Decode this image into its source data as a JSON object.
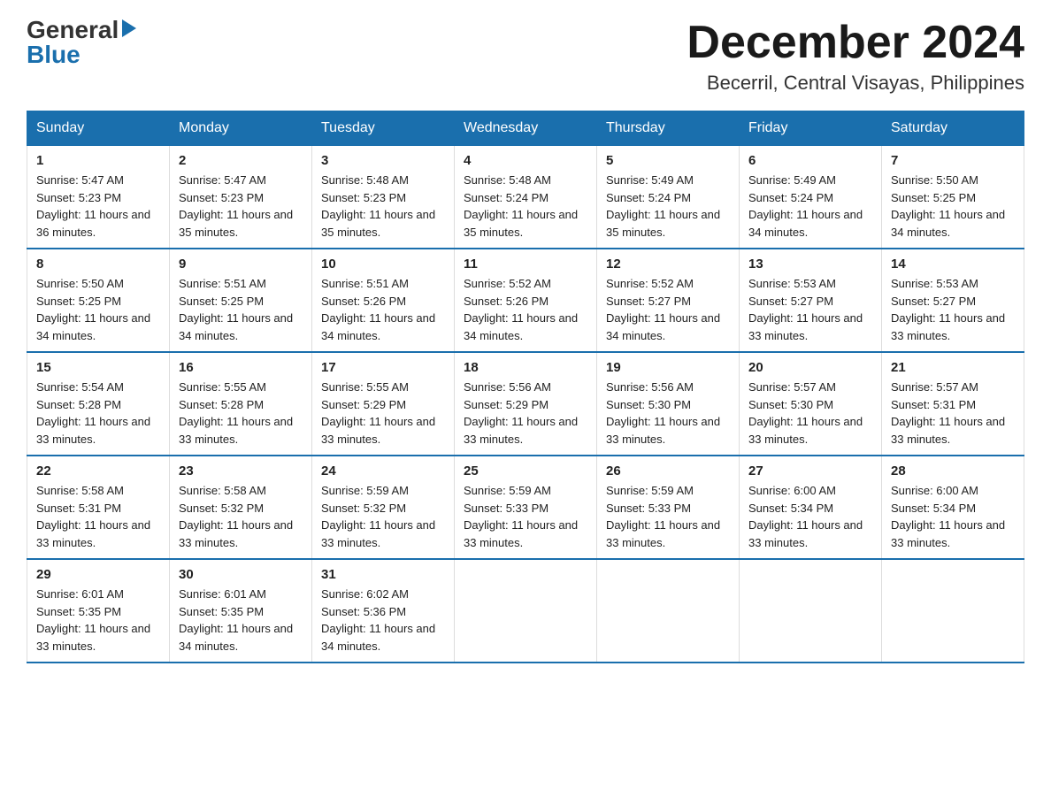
{
  "header": {
    "logo_general": "General",
    "logo_blue": "Blue",
    "month_title": "December 2024",
    "location": "Becerril, Central Visayas, Philippines"
  },
  "weekdays": [
    "Sunday",
    "Monday",
    "Tuesday",
    "Wednesday",
    "Thursday",
    "Friday",
    "Saturday"
  ],
  "weeks": [
    [
      {
        "day": "1",
        "sunrise": "5:47 AM",
        "sunset": "5:23 PM",
        "daylight": "11 hours and 36 minutes."
      },
      {
        "day": "2",
        "sunrise": "5:47 AM",
        "sunset": "5:23 PM",
        "daylight": "11 hours and 35 minutes."
      },
      {
        "day": "3",
        "sunrise": "5:48 AM",
        "sunset": "5:23 PM",
        "daylight": "11 hours and 35 minutes."
      },
      {
        "day": "4",
        "sunrise": "5:48 AM",
        "sunset": "5:24 PM",
        "daylight": "11 hours and 35 minutes."
      },
      {
        "day": "5",
        "sunrise": "5:49 AM",
        "sunset": "5:24 PM",
        "daylight": "11 hours and 35 minutes."
      },
      {
        "day": "6",
        "sunrise": "5:49 AM",
        "sunset": "5:24 PM",
        "daylight": "11 hours and 34 minutes."
      },
      {
        "day": "7",
        "sunrise": "5:50 AM",
        "sunset": "5:25 PM",
        "daylight": "11 hours and 34 minutes."
      }
    ],
    [
      {
        "day": "8",
        "sunrise": "5:50 AM",
        "sunset": "5:25 PM",
        "daylight": "11 hours and 34 minutes."
      },
      {
        "day": "9",
        "sunrise": "5:51 AM",
        "sunset": "5:25 PM",
        "daylight": "11 hours and 34 minutes."
      },
      {
        "day": "10",
        "sunrise": "5:51 AM",
        "sunset": "5:26 PM",
        "daylight": "11 hours and 34 minutes."
      },
      {
        "day": "11",
        "sunrise": "5:52 AM",
        "sunset": "5:26 PM",
        "daylight": "11 hours and 34 minutes."
      },
      {
        "day": "12",
        "sunrise": "5:52 AM",
        "sunset": "5:27 PM",
        "daylight": "11 hours and 34 minutes."
      },
      {
        "day": "13",
        "sunrise": "5:53 AM",
        "sunset": "5:27 PM",
        "daylight": "11 hours and 33 minutes."
      },
      {
        "day": "14",
        "sunrise": "5:53 AM",
        "sunset": "5:27 PM",
        "daylight": "11 hours and 33 minutes."
      }
    ],
    [
      {
        "day": "15",
        "sunrise": "5:54 AM",
        "sunset": "5:28 PM",
        "daylight": "11 hours and 33 minutes."
      },
      {
        "day": "16",
        "sunrise": "5:55 AM",
        "sunset": "5:28 PM",
        "daylight": "11 hours and 33 minutes."
      },
      {
        "day": "17",
        "sunrise": "5:55 AM",
        "sunset": "5:29 PM",
        "daylight": "11 hours and 33 minutes."
      },
      {
        "day": "18",
        "sunrise": "5:56 AM",
        "sunset": "5:29 PM",
        "daylight": "11 hours and 33 minutes."
      },
      {
        "day": "19",
        "sunrise": "5:56 AM",
        "sunset": "5:30 PM",
        "daylight": "11 hours and 33 minutes."
      },
      {
        "day": "20",
        "sunrise": "5:57 AM",
        "sunset": "5:30 PM",
        "daylight": "11 hours and 33 minutes."
      },
      {
        "day": "21",
        "sunrise": "5:57 AM",
        "sunset": "5:31 PM",
        "daylight": "11 hours and 33 minutes."
      }
    ],
    [
      {
        "day": "22",
        "sunrise": "5:58 AM",
        "sunset": "5:31 PM",
        "daylight": "11 hours and 33 minutes."
      },
      {
        "day": "23",
        "sunrise": "5:58 AM",
        "sunset": "5:32 PM",
        "daylight": "11 hours and 33 minutes."
      },
      {
        "day": "24",
        "sunrise": "5:59 AM",
        "sunset": "5:32 PM",
        "daylight": "11 hours and 33 minutes."
      },
      {
        "day": "25",
        "sunrise": "5:59 AM",
        "sunset": "5:33 PM",
        "daylight": "11 hours and 33 minutes."
      },
      {
        "day": "26",
        "sunrise": "5:59 AM",
        "sunset": "5:33 PM",
        "daylight": "11 hours and 33 minutes."
      },
      {
        "day": "27",
        "sunrise": "6:00 AM",
        "sunset": "5:34 PM",
        "daylight": "11 hours and 33 minutes."
      },
      {
        "day": "28",
        "sunrise": "6:00 AM",
        "sunset": "5:34 PM",
        "daylight": "11 hours and 33 minutes."
      }
    ],
    [
      {
        "day": "29",
        "sunrise": "6:01 AM",
        "sunset": "5:35 PM",
        "daylight": "11 hours and 33 minutes."
      },
      {
        "day": "30",
        "sunrise": "6:01 AM",
        "sunset": "5:35 PM",
        "daylight": "11 hours and 34 minutes."
      },
      {
        "day": "31",
        "sunrise": "6:02 AM",
        "sunset": "5:36 PM",
        "daylight": "11 hours and 34 minutes."
      },
      null,
      null,
      null,
      null
    ]
  ]
}
